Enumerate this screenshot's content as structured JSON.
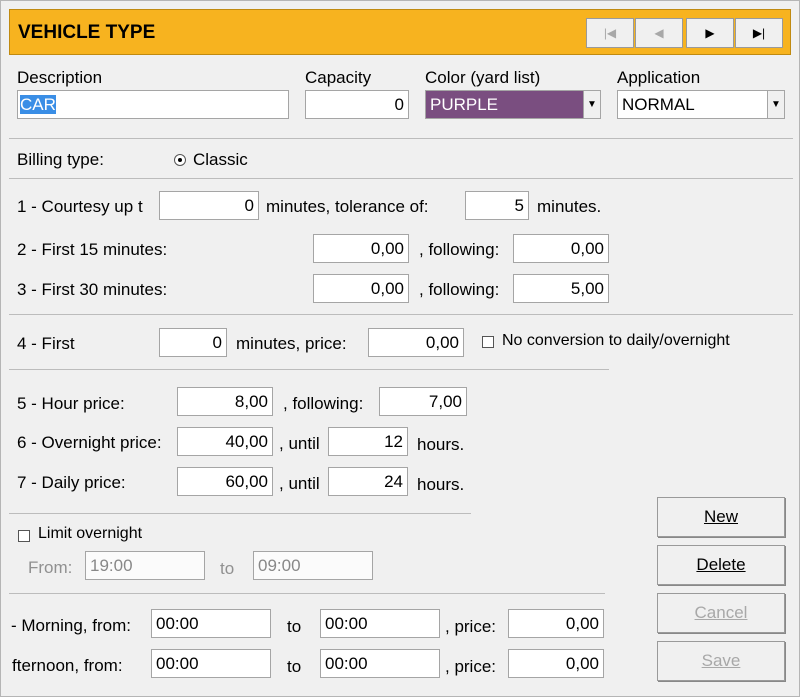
{
  "header": {
    "title": "VEHICLE TYPE"
  },
  "labels": {
    "description": "Description",
    "capacity": "Capacity",
    "color": "Color (yard list)",
    "application": "Application",
    "billing_type": "Billing type:",
    "classic": "Classic",
    "courtesy": "1 - Courtesy up t",
    "minutes_tolerance": "minutes, tolerance of:",
    "minutes_dot": "minutes.",
    "first15": "2 - First 15 minutes:",
    "first30": "3 - First 30 minutes:",
    "following": ", following:",
    "first": "4 - First",
    "minutes_price": "minutes, price:",
    "no_conversion": "No conversion to daily/overnight",
    "hour_price": "5 - Hour price:",
    "following2": ", following:",
    "overnight_price": "6 - Overnight price:",
    "until": ", until",
    "hours": "hours.",
    "daily_price": "7 - Daily price:",
    "until2": ", until",
    "hours2": "hours.",
    "limit_overnight": "Limit overnight",
    "from": "From:",
    "to": "to",
    "morning_from": "- Morning, from:",
    "afternoon_from": "fternoon, from:",
    "to2": "to",
    "to3": "to",
    "price": ", price:",
    "price2": ", price:"
  },
  "fields": {
    "description": "CAR",
    "capacity": "0",
    "color": "PURPLE",
    "application": "NORMAL",
    "courtesy_minutes": "0",
    "tolerance": "5",
    "first15": "0,00",
    "first15_following": "0,00",
    "first30": "0,00",
    "first30_following": "5,00",
    "first_minutes": "0",
    "first_price": "0,00",
    "hour_price": "8,00",
    "hour_following": "7,00",
    "overnight_price": "40,00",
    "overnight_until": "12",
    "daily_price": "60,00",
    "daily_until": "24",
    "limit_from": "19:00",
    "limit_to": "09:00",
    "morning_from": "00:00",
    "morning_to": "00:00",
    "morning_price": "0,00",
    "afternoon_from": "00:00",
    "afternoon_to": "00:00",
    "afternoon_price": "0,00"
  },
  "buttons": {
    "new": "New",
    "delete": "Delete",
    "cancel": "Cancel",
    "save": "Save"
  },
  "colors": {
    "header": "#f7b31f",
    "purple": "#7a4e80"
  }
}
